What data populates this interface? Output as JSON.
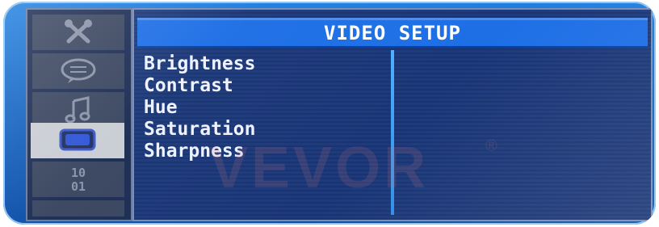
{
  "menu": {
    "title": "VIDEO SETUP",
    "items": [
      {
        "label": "Brightness"
      },
      {
        "label": "Contrast"
      },
      {
        "label": "Hue"
      },
      {
        "label": "Saturation"
      },
      {
        "label": "Sharpness"
      }
    ]
  },
  "rail": {
    "icons": [
      "tools-icon",
      "speech-bubble-icon",
      "music-note-icon",
      "monitor-icon",
      "binary-digits-icon",
      "blank-slot"
    ],
    "active": "monitor-icon",
    "binary_glyph_top": "10",
    "binary_glyph_bottom": "01"
  },
  "watermark": {
    "text": "VEVOR",
    "mark": "®"
  },
  "colors": {
    "title_bar": "#1e6fe6",
    "panel_bg": "#1d3a7c",
    "divider": "#3aa0ff",
    "text": "#eef2ff",
    "active_tab": "#c9cdd4"
  }
}
